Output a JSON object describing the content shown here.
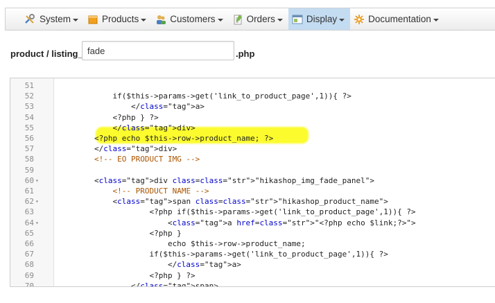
{
  "menu": [
    {
      "label": "System",
      "icon": "tools-icon",
      "active": false
    },
    {
      "label": "Products",
      "icon": "box-icon",
      "active": false
    },
    {
      "label": "Customers",
      "icon": "customers-icon",
      "active": false
    },
    {
      "label": "Orders",
      "icon": "orders-icon",
      "active": false
    },
    {
      "label": "Display",
      "icon": "display-icon",
      "active": true
    },
    {
      "label": "Documentation",
      "icon": "documentation-icon",
      "active": false
    }
  ],
  "path": {
    "prefix": "product / listing_",
    "value": "fade",
    "suffix": ".php"
  },
  "editor": {
    "lines": [
      {
        "n": "51",
        "fold": false,
        "code": ""
      },
      {
        "n": "52",
        "fold": false,
        "code": "            if($this->params->get('link_to_product_page',1)){ ?>"
      },
      {
        "n": "53",
        "fold": false,
        "code": "                </a>"
      },
      {
        "n": "54",
        "fold": false,
        "code": "            <?php } ?>"
      },
      {
        "n": "55",
        "fold": false,
        "code": "            </div>"
      },
      {
        "n": "56",
        "fold": false,
        "code": "        <?php echo $this->row->product_name; ?>"
      },
      {
        "n": "57",
        "fold": false,
        "code": "        </div>"
      },
      {
        "n": "58",
        "fold": false,
        "code": "        <!-- EO PRODUCT IMG -->"
      },
      {
        "n": "59",
        "fold": false,
        "code": ""
      },
      {
        "n": "60",
        "fold": true,
        "code": "        <div class=\"hikashop_img_fade_panel\">"
      },
      {
        "n": "61",
        "fold": false,
        "code": "            <!-- PRODUCT NAME -->"
      },
      {
        "n": "62",
        "fold": true,
        "code": "            <span class=\"hikashop_product_name\">"
      },
      {
        "n": "63",
        "fold": false,
        "code": "                    <?php if($this->params->get('link_to_product_page',1)){ ?>"
      },
      {
        "n": "64",
        "fold": true,
        "code": "                        <a href=\"<?php echo $link;?>\">"
      },
      {
        "n": "65",
        "fold": false,
        "code": "                    <?php }"
      },
      {
        "n": "66",
        "fold": false,
        "code": "                        echo $this->row->product_name;"
      },
      {
        "n": "67",
        "fold": false,
        "code": "                    if($this->params->get('link_to_product_page',1)){ ?>"
      },
      {
        "n": "68",
        "fold": false,
        "code": "                        </a>"
      },
      {
        "n": "69",
        "fold": false,
        "code": "                    <?php } ?>"
      },
      {
        "n": "70",
        "fold": false,
        "code": "                </span>"
      }
    ]
  },
  "colors": {
    "highlight": "#fbfb2e",
    "active_menu": "#c3dcf2"
  }
}
